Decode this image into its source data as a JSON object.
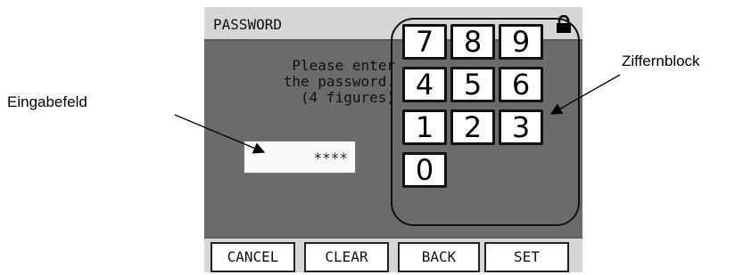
{
  "screen": {
    "title": "PASSWORD",
    "prompt_lines": [
      "Please enter",
      "the password.",
      "(4 figures)"
    ],
    "entry_value": "****",
    "keys": [
      "7",
      "8",
      "9",
      "4",
      "5",
      "6",
      "1",
      "2",
      "3",
      "0"
    ],
    "buttons": {
      "cancel": "CANCEL",
      "clear": "CLEAR",
      "back": "BACK",
      "set": "SET"
    },
    "icons": {
      "lock": "lock-icon"
    }
  },
  "callouts": {
    "input_field": "Eingabefeld",
    "keypad": "Ziffernblock"
  },
  "colors": {
    "screen_bg": "#6b6b6b",
    "bar_bg": "#d6d6d6",
    "key_bg": "#ffffff"
  }
}
